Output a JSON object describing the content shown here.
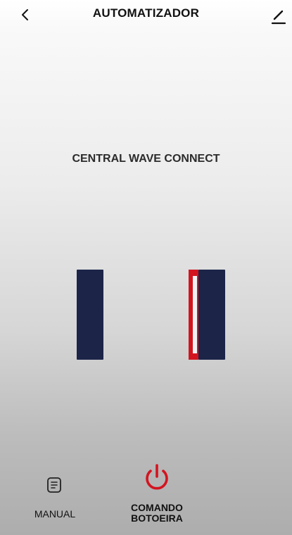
{
  "header": {
    "title": "AUTOMATIZADOR",
    "back_icon": "chevron-left-icon",
    "edit_icon": "pencil-icon"
  },
  "device": {
    "name": "CENTRAL WAVE CONNECT"
  },
  "gate": {
    "status_color": "#d3141f",
    "panel_color": "#1c2448"
  },
  "bottom_nav": {
    "manual_label": "MANUAL",
    "manual_icon": "document-icon",
    "command_label_line1": "COMANDO",
    "command_label_line2": "BOTOEIRA",
    "command_icon": "power-icon",
    "command_color": "#d3141f"
  }
}
